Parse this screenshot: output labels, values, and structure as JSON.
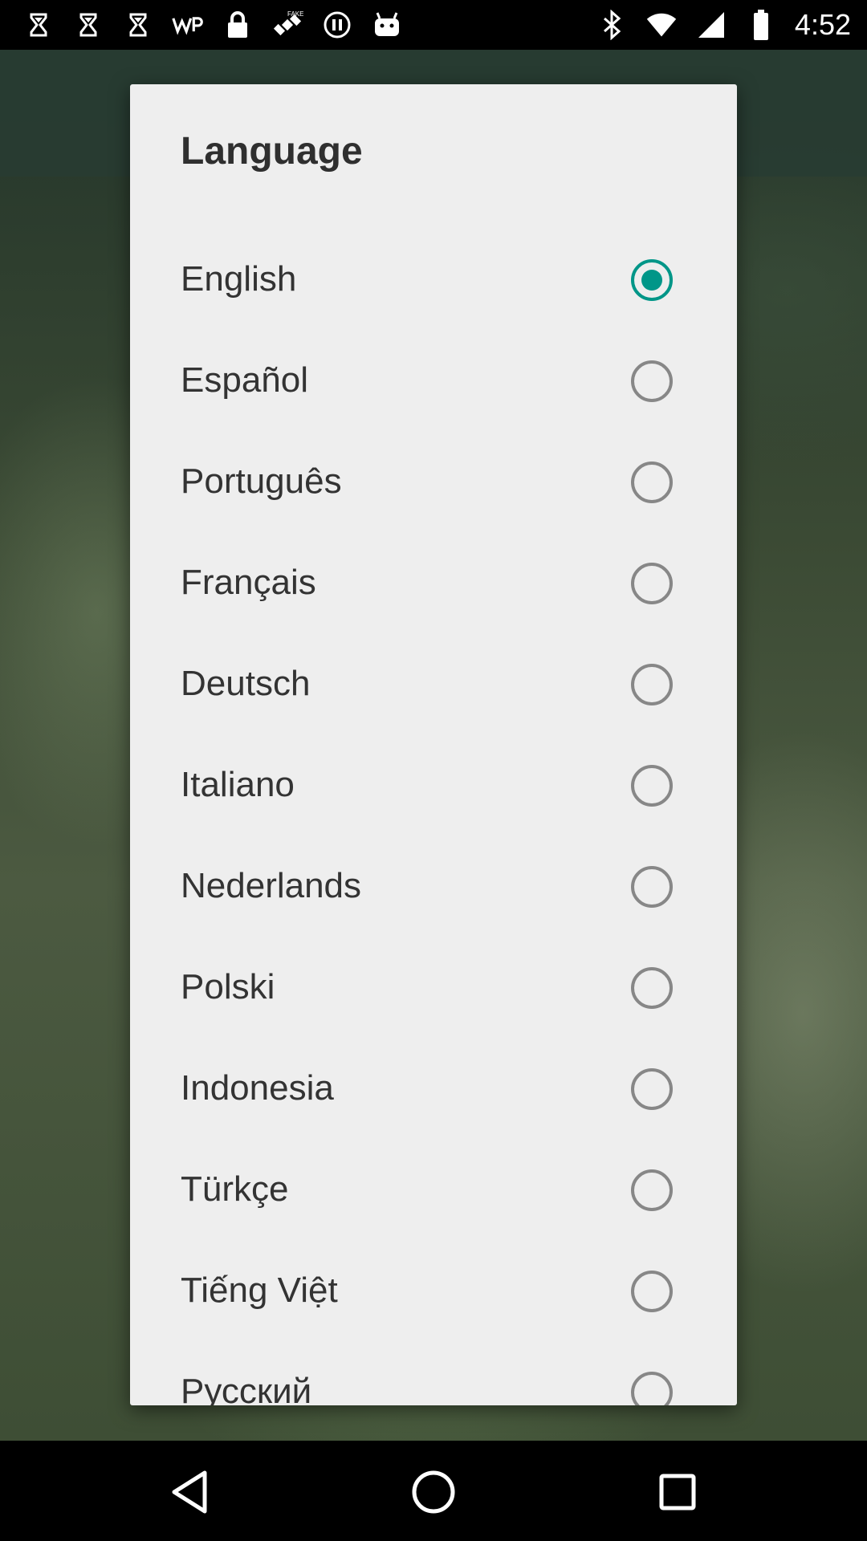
{
  "status_bar": {
    "carrier_badge": "FAKE",
    "time": "4:52",
    "left_icons": [
      "hourglass-icon",
      "hourglass-icon",
      "hourglass-icon",
      "wp-icon",
      "lock-icon",
      "satellite-icon",
      "circle-pause-icon",
      "android-icon"
    ],
    "right_icons": [
      "bluetooth-icon",
      "wifi-icon",
      "signal-icon",
      "battery-icon"
    ]
  },
  "dialog": {
    "title": "Language",
    "accent_color": "#009688",
    "selected_index": 0,
    "options": [
      {
        "label": "English",
        "selected": true
      },
      {
        "label": "Español",
        "selected": false
      },
      {
        "label": "Português",
        "selected": false
      },
      {
        "label": "Français",
        "selected": false
      },
      {
        "label": "Deutsch",
        "selected": false
      },
      {
        "label": "Italiano",
        "selected": false
      },
      {
        "label": "Nederlands",
        "selected": false
      },
      {
        "label": "Polski",
        "selected": false
      },
      {
        "label": "Indonesia",
        "selected": false
      },
      {
        "label": "Türkçe",
        "selected": false
      },
      {
        "label": "Tiếng Việt",
        "selected": false
      },
      {
        "label": "Русский",
        "selected": false
      }
    ]
  },
  "nav_bar": {
    "buttons": [
      "back-icon",
      "home-icon",
      "recents-icon"
    ]
  }
}
